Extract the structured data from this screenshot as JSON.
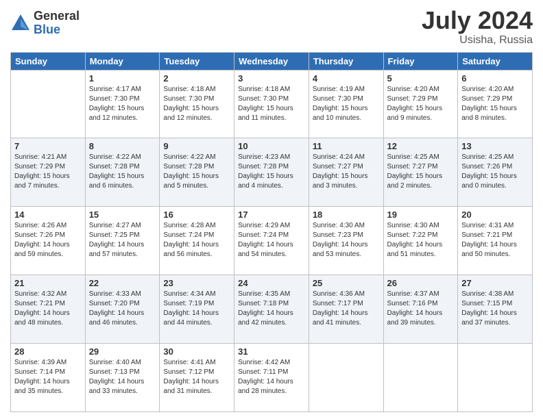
{
  "logo": {
    "general": "General",
    "blue": "Blue"
  },
  "header": {
    "title": "July 2024",
    "subtitle": "Usisha, Russia"
  },
  "weekdays": [
    "Sunday",
    "Monday",
    "Tuesday",
    "Wednesday",
    "Thursday",
    "Friday",
    "Saturday"
  ],
  "weeks": [
    [
      {
        "day": "",
        "info": ""
      },
      {
        "day": "1",
        "info": "Sunrise: 4:17 AM\nSunset: 7:30 PM\nDaylight: 15 hours\nand 12 minutes."
      },
      {
        "day": "2",
        "info": "Sunrise: 4:18 AM\nSunset: 7:30 PM\nDaylight: 15 hours\nand 12 minutes."
      },
      {
        "day": "3",
        "info": "Sunrise: 4:18 AM\nSunset: 7:30 PM\nDaylight: 15 hours\nand 11 minutes."
      },
      {
        "day": "4",
        "info": "Sunrise: 4:19 AM\nSunset: 7:30 PM\nDaylight: 15 hours\nand 10 minutes."
      },
      {
        "day": "5",
        "info": "Sunrise: 4:20 AM\nSunset: 7:29 PM\nDaylight: 15 hours\nand 9 minutes."
      },
      {
        "day": "6",
        "info": "Sunrise: 4:20 AM\nSunset: 7:29 PM\nDaylight: 15 hours\nand 8 minutes."
      }
    ],
    [
      {
        "day": "7",
        "info": "Sunrise: 4:21 AM\nSunset: 7:29 PM\nDaylight: 15 hours\nand 7 minutes."
      },
      {
        "day": "8",
        "info": "Sunrise: 4:22 AM\nSunset: 7:28 PM\nDaylight: 15 hours\nand 6 minutes."
      },
      {
        "day": "9",
        "info": "Sunrise: 4:22 AM\nSunset: 7:28 PM\nDaylight: 15 hours\nand 5 minutes."
      },
      {
        "day": "10",
        "info": "Sunrise: 4:23 AM\nSunset: 7:28 PM\nDaylight: 15 hours\nand 4 minutes."
      },
      {
        "day": "11",
        "info": "Sunrise: 4:24 AM\nSunset: 7:27 PM\nDaylight: 15 hours\nand 3 minutes."
      },
      {
        "day": "12",
        "info": "Sunrise: 4:25 AM\nSunset: 7:27 PM\nDaylight: 15 hours\nand 2 minutes."
      },
      {
        "day": "13",
        "info": "Sunrise: 4:25 AM\nSunset: 7:26 PM\nDaylight: 15 hours\nand 0 minutes."
      }
    ],
    [
      {
        "day": "14",
        "info": "Sunrise: 4:26 AM\nSunset: 7:26 PM\nDaylight: 14 hours\nand 59 minutes."
      },
      {
        "day": "15",
        "info": "Sunrise: 4:27 AM\nSunset: 7:25 PM\nDaylight: 14 hours\nand 57 minutes."
      },
      {
        "day": "16",
        "info": "Sunrise: 4:28 AM\nSunset: 7:24 PM\nDaylight: 14 hours\nand 56 minutes."
      },
      {
        "day": "17",
        "info": "Sunrise: 4:29 AM\nSunset: 7:24 PM\nDaylight: 14 hours\nand 54 minutes."
      },
      {
        "day": "18",
        "info": "Sunrise: 4:30 AM\nSunset: 7:23 PM\nDaylight: 14 hours\nand 53 minutes."
      },
      {
        "day": "19",
        "info": "Sunrise: 4:30 AM\nSunset: 7:22 PM\nDaylight: 14 hours\nand 51 minutes."
      },
      {
        "day": "20",
        "info": "Sunrise: 4:31 AM\nSunset: 7:21 PM\nDaylight: 14 hours\nand 50 minutes."
      }
    ],
    [
      {
        "day": "21",
        "info": "Sunrise: 4:32 AM\nSunset: 7:21 PM\nDaylight: 14 hours\nand 48 minutes."
      },
      {
        "day": "22",
        "info": "Sunrise: 4:33 AM\nSunset: 7:20 PM\nDaylight: 14 hours\nand 46 minutes."
      },
      {
        "day": "23",
        "info": "Sunrise: 4:34 AM\nSunset: 7:19 PM\nDaylight: 14 hours\nand 44 minutes."
      },
      {
        "day": "24",
        "info": "Sunrise: 4:35 AM\nSunset: 7:18 PM\nDaylight: 14 hours\nand 42 minutes."
      },
      {
        "day": "25",
        "info": "Sunrise: 4:36 AM\nSunset: 7:17 PM\nDaylight: 14 hours\nand 41 minutes."
      },
      {
        "day": "26",
        "info": "Sunrise: 4:37 AM\nSunset: 7:16 PM\nDaylight: 14 hours\nand 39 minutes."
      },
      {
        "day": "27",
        "info": "Sunrise: 4:38 AM\nSunset: 7:15 PM\nDaylight: 14 hours\nand 37 minutes."
      }
    ],
    [
      {
        "day": "28",
        "info": "Sunrise: 4:39 AM\nSunset: 7:14 PM\nDaylight: 14 hours\nand 35 minutes."
      },
      {
        "day": "29",
        "info": "Sunrise: 4:40 AM\nSunset: 7:13 PM\nDaylight: 14 hours\nand 33 minutes."
      },
      {
        "day": "30",
        "info": "Sunrise: 4:41 AM\nSunset: 7:12 PM\nDaylight: 14 hours\nand 31 minutes."
      },
      {
        "day": "31",
        "info": "Sunrise: 4:42 AM\nSunset: 7:11 PM\nDaylight: 14 hours\nand 28 minutes."
      },
      {
        "day": "",
        "info": ""
      },
      {
        "day": "",
        "info": ""
      },
      {
        "day": "",
        "info": ""
      }
    ]
  ]
}
